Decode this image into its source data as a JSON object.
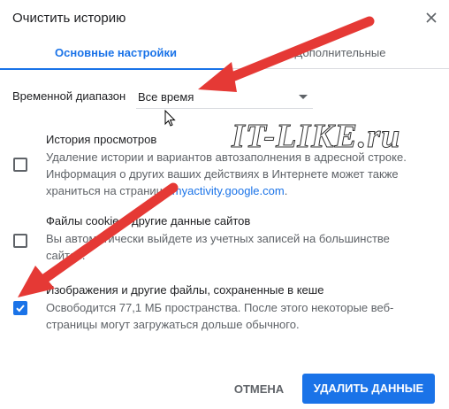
{
  "dialog": {
    "title": "Очистить историю",
    "close_icon": "close-icon"
  },
  "tabs": [
    {
      "label": "Основные настройки",
      "active": true
    },
    {
      "label": "Дополнительные",
      "active": false
    }
  ],
  "time_range": {
    "label": "Временной диапазон",
    "value": "Все время"
  },
  "items": [
    {
      "title": "История просмотров",
      "description": "Удаление истории и вариантов автозаполнения в адресной строке. Информация о других ваших действиях в Интернете может также храниться на странице ",
      "link": "myactivity.google.com",
      "suffix": ".",
      "checked": false
    },
    {
      "title": "Файлы cookie и другие данные сайтов",
      "description": "Вы автоматически выйдете из учетных записей на большинстве сайтов.",
      "checked": false
    },
    {
      "title": "Изображения и другие файлы, сохраненные в кеше",
      "description": "Освободится 77,1 МБ пространства. После этого некоторые веб-страницы могут загружаться дольше обычного.",
      "checked": true
    }
  ],
  "buttons": {
    "cancel": "ОТМЕНА",
    "delete": "УДАЛИТЬ ДАННЫЕ"
  },
  "watermark": "IT-LIKE.ru",
  "colors": {
    "accent": "#1a73e8",
    "arrow": "#e53935",
    "text": "#202124",
    "secondary": "#5f6368"
  }
}
